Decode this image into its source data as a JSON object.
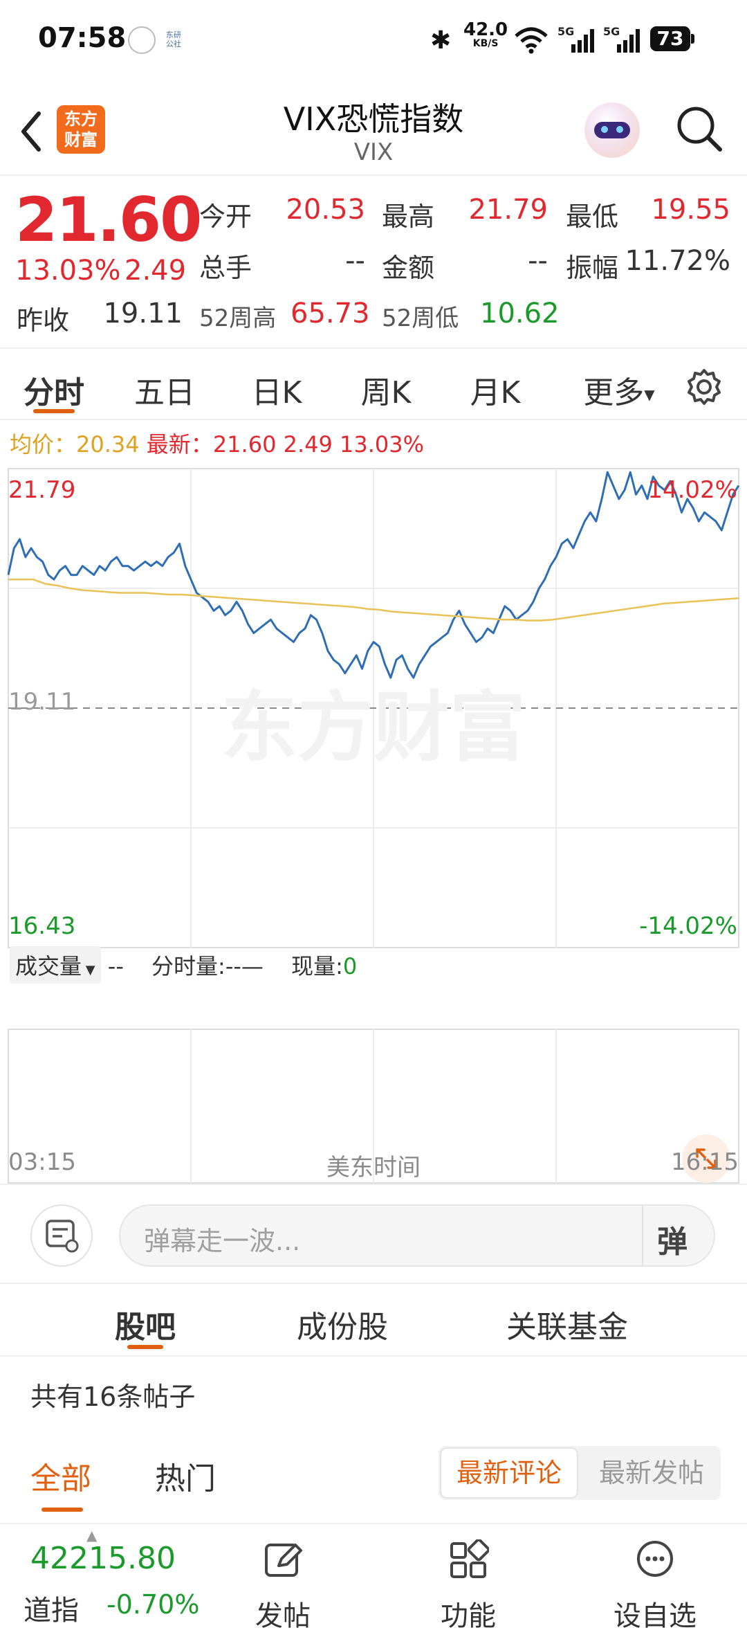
{
  "status": {
    "time": "07:58",
    "net_speed": "42.0",
    "net_unit": "KB/S",
    "signal1": "5G",
    "signal2": "5G",
    "battery": "73",
    "app_mini": "东研\n公社"
  },
  "nav": {
    "title": "VIX恐慌指数",
    "subtitle": "VIX",
    "logo_line1": "东方",
    "logo_line2": "财富"
  },
  "quote": {
    "price": "21.60",
    "change_pct": "13.03%",
    "change": "2.49",
    "prev_close_label": "昨收",
    "prev_close": "19.11",
    "open_label": "今开",
    "open": "20.53",
    "high_label": "最高",
    "high": "21.79",
    "low_label": "最低",
    "low": "19.55",
    "volume_label": "总手",
    "volume": "--",
    "amount_label": "金额",
    "amount": "--",
    "amplitude_label": "振幅",
    "amplitude": "11.72%",
    "w52_high_label": "52周高",
    "w52_high": "65.73",
    "w52_low_label": "52周低",
    "w52_low": "10.62"
  },
  "tabs": [
    {
      "label": "分时"
    },
    {
      "label": "五日"
    },
    {
      "label": "日K"
    },
    {
      "label": "周K"
    },
    {
      "label": "月K"
    },
    {
      "label": "更多"
    }
  ],
  "chart_info": {
    "avg_label": "均价：",
    "avg": "20.34",
    "latest_label": "最新：",
    "latest": "21.60",
    "change": "2.49",
    "change_pct": "13.03%",
    "watermark": "东方财富"
  },
  "chart_data": {
    "type": "line",
    "ylim": [
      16.43,
      21.79
    ],
    "x_start": "03:15",
    "x_end": "16:15",
    "x_label": "美东时间",
    "y_top": "21.79",
    "y_bottom": "16.43",
    "y_mid": "19.11",
    "pct_top": "14.02%",
    "pct_bottom": "-14.02%",
    "series": [
      {
        "values": [
          20.6,
          20.9,
          21.0,
          20.8,
          20.9,
          20.8,
          20.75,
          20.6,
          20.55,
          20.65,
          20.7,
          20.6,
          20.6,
          20.7,
          20.65,
          20.6,
          20.7,
          20.65,
          20.75,
          20.8,
          20.7,
          20.7,
          20.65,
          20.7,
          20.75,
          20.7,
          20.75,
          20.7,
          20.8,
          20.85,
          20.95,
          20.7,
          20.55,
          20.4,
          20.35,
          20.3,
          20.2,
          20.25,
          20.15,
          20.2,
          20.3,
          20.2,
          20.05,
          19.95,
          20.0,
          20.05,
          20.1,
          20.0,
          19.95,
          19.9,
          19.85,
          19.95,
          20.0,
          20.15,
          20.1,
          19.95,
          19.75,
          19.65,
          19.6,
          19.5,
          19.6,
          19.7,
          19.55,
          19.75,
          19.85,
          19.8,
          19.6,
          19.45,
          19.65,
          19.7,
          19.55,
          19.45,
          19.6,
          19.7,
          19.8,
          19.85,
          19.9,
          19.95,
          20.1,
          20.2,
          20.05,
          19.95,
          19.85,
          19.9,
          20.0,
          19.95,
          20.1,
          20.25,
          20.2,
          20.1,
          20.15,
          20.2,
          20.3,
          20.45,
          20.55,
          20.7,
          20.8,
          20.95,
          21.0,
          20.9,
          21.05,
          21.2,
          21.3,
          21.2,
          21.45,
          21.75,
          21.6,
          21.45,
          21.55,
          21.75,
          21.5,
          21.6,
          21.45,
          21.7,
          21.6,
          21.55,
          21.65,
          21.5,
          21.3,
          21.45,
          21.35,
          21.2,
          21.3,
          21.25,
          21.2,
          21.1,
          21.3,
          21.5,
          21.6
        ]
      },
      {
        "values": [
          20.55,
          20.55,
          20.55,
          20.5,
          20.48,
          20.45,
          20.43,
          20.42,
          20.41,
          20.4,
          20.4,
          20.4,
          20.39,
          20.38,
          20.38,
          20.37,
          20.36,
          20.35,
          20.34,
          20.33,
          20.32,
          20.31,
          20.3,
          20.29,
          20.28,
          20.27,
          20.26,
          20.25,
          20.24,
          20.22,
          20.21,
          20.19,
          20.18,
          20.17,
          20.16,
          20.15,
          20.14,
          20.13,
          20.12,
          20.11,
          20.1,
          20.1,
          20.09,
          20.09,
          20.1,
          20.12,
          20.14,
          20.16,
          20.18,
          20.2,
          20.22,
          20.24,
          20.26,
          20.28,
          20.29,
          20.3,
          20.31,
          20.32,
          20.33,
          20.34
        ]
      }
    ]
  },
  "volume_bar": {
    "dropdown_label": "成交量",
    "value": "--",
    "per_minute_label": "分时量:",
    "per_minute_value": "--",
    "dash": "—",
    "current_label": "现量:",
    "current_value": "0"
  },
  "danmu": {
    "placeholder": "弹幕走一波...",
    "send_label": "弹"
  },
  "guba": {
    "tabs": [
      {
        "label": "股吧"
      },
      {
        "label": "成份股"
      },
      {
        "label": "关联基金"
      }
    ],
    "post_count": "共有16条帖子",
    "filters": [
      {
        "label": "全部"
      },
      {
        "label": "热门"
      }
    ],
    "sort": [
      {
        "label": "最新评论"
      },
      {
        "label": "最新发帖"
      }
    ]
  },
  "bottom": {
    "index_value": "42215.80",
    "index_name": "道指",
    "index_change": "-0.70%",
    "items": [
      {
        "label": "发帖",
        "icon": "edit-icon"
      },
      {
        "label": "功能",
        "icon": "grid-icon"
      },
      {
        "label": "设自选",
        "icon": "chat-icon"
      }
    ]
  },
  "colors": {
    "accent": "#e0600f",
    "up": "#e0282e",
    "down": "#1a9a2a",
    "line": "#2f6db5",
    "avg": "#e8c257"
  }
}
